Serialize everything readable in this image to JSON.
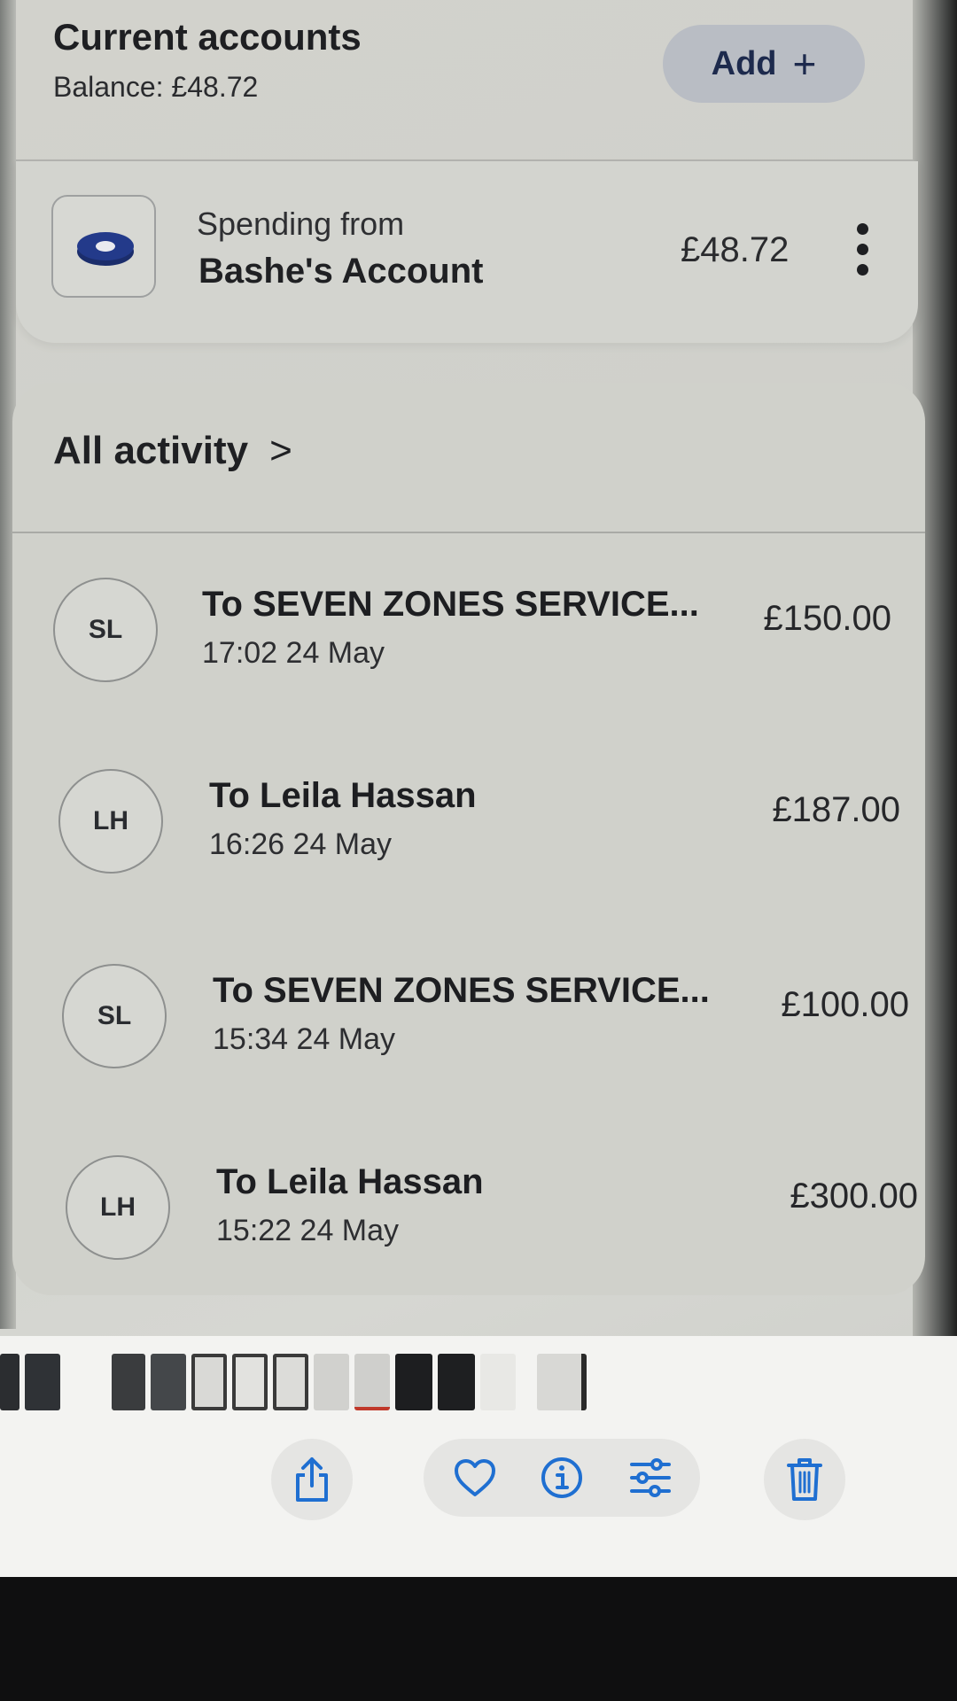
{
  "header": {
    "title": "Current accounts",
    "balance": "Balance: £48.72",
    "add_label": "Add",
    "add_icon": "plus-icon"
  },
  "account": {
    "spending_label": "Spending from",
    "name": "Bashe's Account",
    "balance": "£48.72",
    "icon": "account-card-icon",
    "menu_icon": "kebab-menu-icon"
  },
  "activity": {
    "title": "All activity",
    "chevron_icon": "chevron-right-icon",
    "transactions": [
      {
        "initials": "SL",
        "name": "To SEVEN ZONES SERVICE...",
        "time": "17:02 24 May",
        "amount": "£150.00"
      },
      {
        "initials": "LH",
        "name": "To Leila Hassan",
        "time": "16:26 24 May",
        "amount": "£187.00"
      },
      {
        "initials": "SL",
        "name": "To SEVEN ZONES SERVICE...",
        "time": "15:34 24 May",
        "amount": "£100.00"
      },
      {
        "initials": "LH",
        "name": "To Leila Hassan",
        "time": "15:22 24 May",
        "amount": "£300.00"
      }
    ]
  },
  "photos_toolbar": {
    "icons": [
      "share-icon",
      "heart-icon",
      "info-icon",
      "adjust-icon",
      "trash-icon"
    ]
  },
  "colors": {
    "accent_navy": "#1d2a4d",
    "ios_blue": "#1f6fd1"
  }
}
